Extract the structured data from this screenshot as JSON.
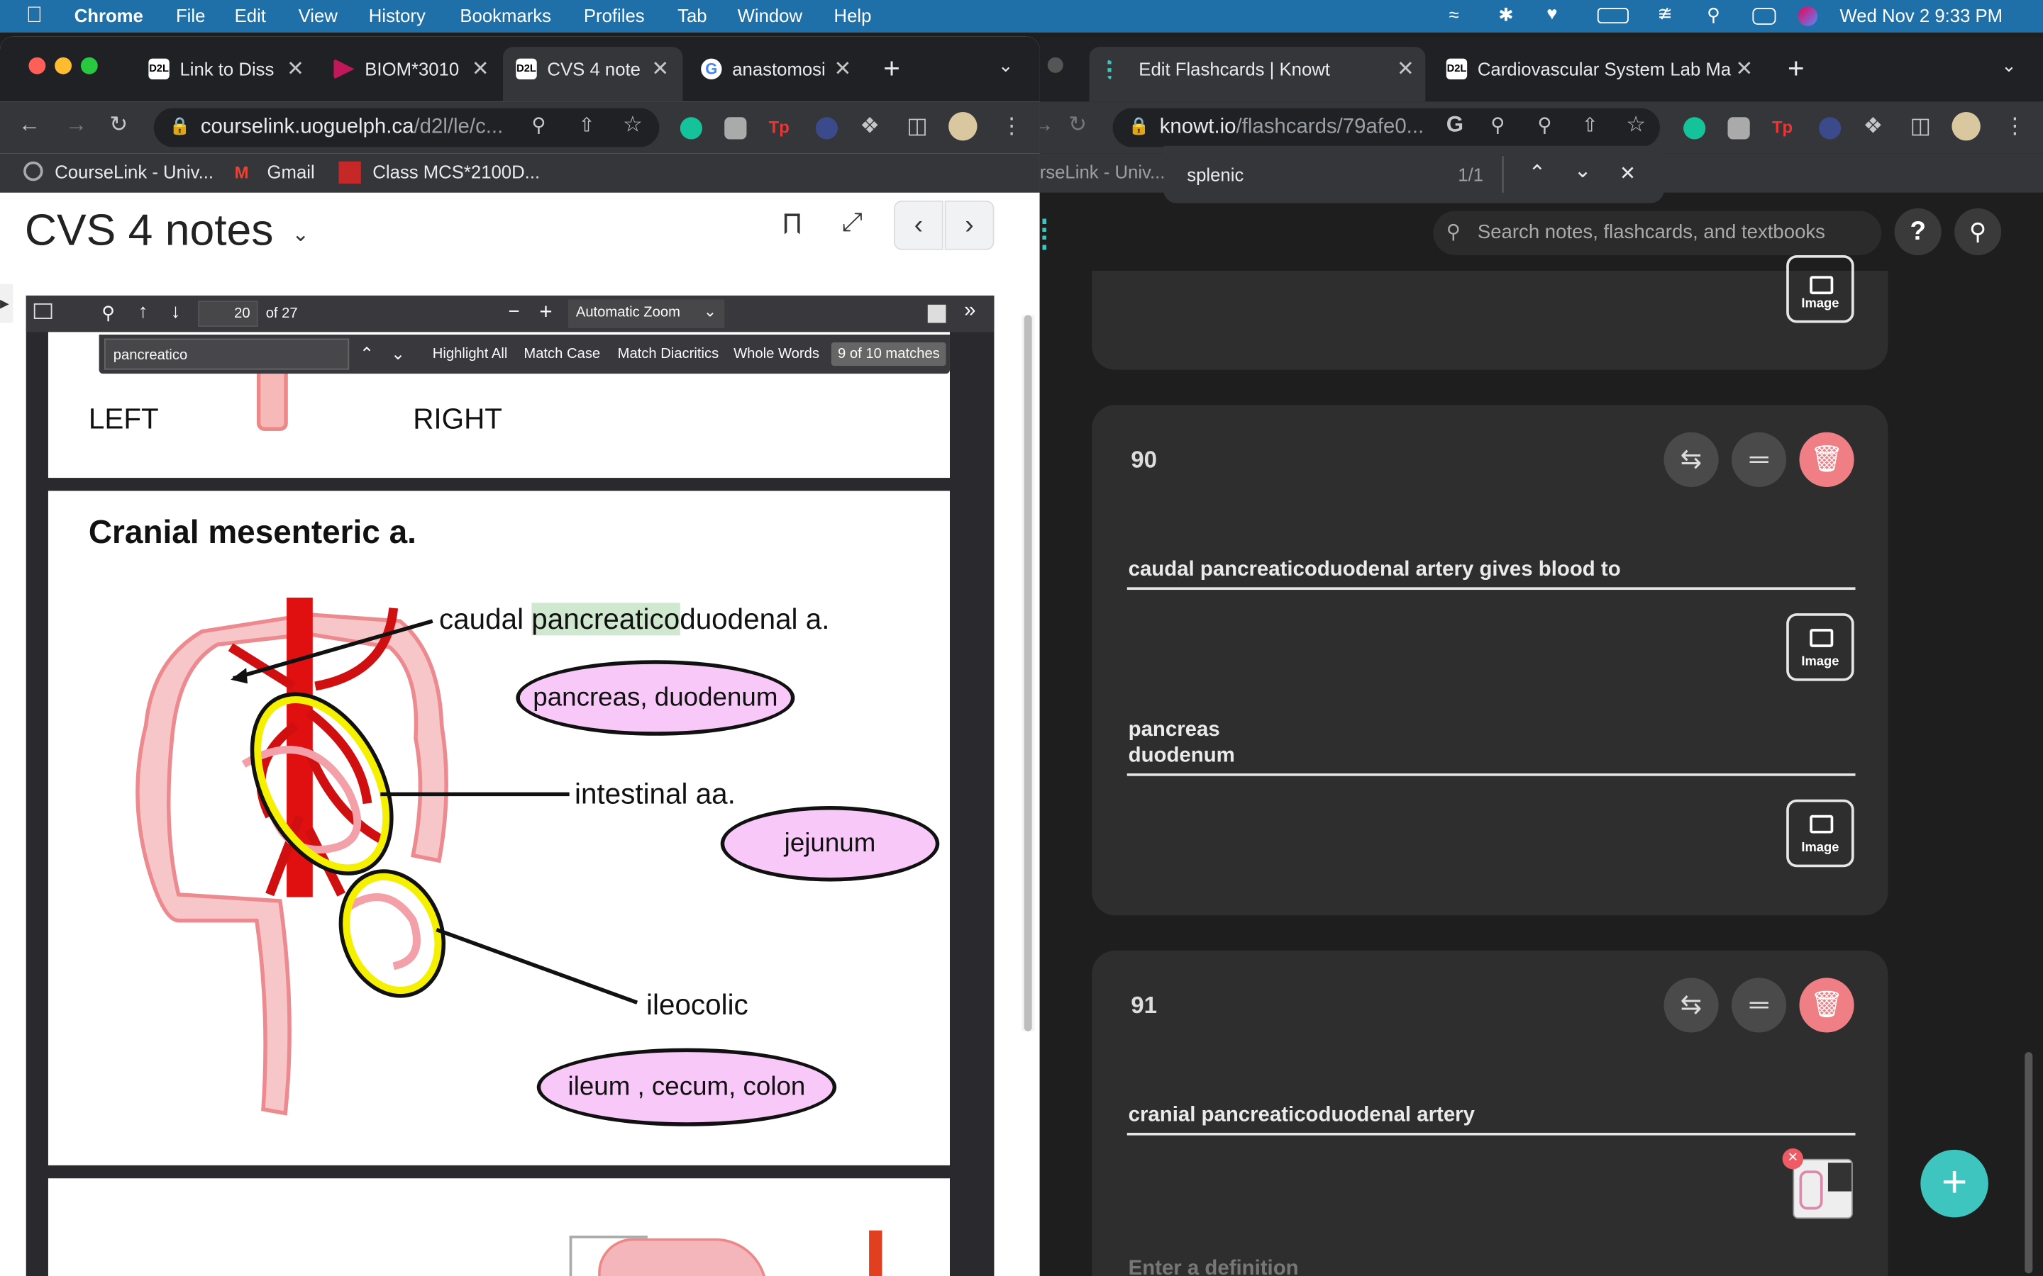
{
  "menubar": {
    "app": "Chrome",
    "items": [
      "File",
      "Edit",
      "View",
      "History",
      "Bookmarks",
      "Profiles",
      "Tab",
      "Window",
      "Help"
    ],
    "datetime": "Wed Nov 2  9:33 PM"
  },
  "left_window": {
    "tabs": [
      {
        "label": "Link to Diss",
        "fav": "D2L"
      },
      {
        "label": "BIOM*3010",
        "fav": "B"
      },
      {
        "label": "CVS 4 note",
        "fav": "D2L"
      },
      {
        "label": "anastomosi",
        "fav": "G"
      }
    ],
    "url_host": "courselink.uoguelph.ca",
    "url_path": "/d2l/le/c...",
    "bookmarks": [
      "CourseLink - Univ...",
      "Gmail",
      "Class MCS*2100D..."
    ],
    "doc_title": "CVS 4 notes",
    "pdf": {
      "page_number": "20",
      "page_of": "of 27",
      "zoom": "Automatic Zoom",
      "find_query": "pancreatico",
      "find_options": [
        "Highlight All",
        "Match Case",
        "Match Diacritics",
        "Whole Words"
      ],
      "find_result": "9 of 10 matches",
      "prev_page": {
        "left": "LEFT",
        "right": "RIGHT"
      },
      "page": {
        "heading": "Cranial mesenteric a.",
        "label_caudal_pre": "caudal ",
        "label_caudal_hl": "pancreatico",
        "label_caudal_post": "duodenal a.",
        "label_intestinal": "intestinal aa.",
        "label_ileocolic": "ileocolic",
        "pill_pancreas": "pancreas, duodenum",
        "pill_jejunum": "jejunum",
        "pill_ileum": "ileum , cecum, colon"
      }
    }
  },
  "right_window": {
    "tabs": [
      {
        "label": "Edit Flashcards | Knowt"
      },
      {
        "label": "Cardiovascular System Lab Ma",
        "fav": "D2L"
      }
    ],
    "url_host": "knowt.io",
    "url_path": "/flashcards/79afe0...",
    "bookmark_partial": "rseLink - Univ...",
    "find": {
      "query": "splenic",
      "count": "1/1"
    },
    "search_placeholder": "Search notes, flashcards, and textbooks",
    "image_btn": "Image",
    "cards": [
      {
        "number": "90",
        "term": "caudal pancreaticoduodenal artery gives blood to",
        "definition_line1": "pancreas",
        "definition_line2": "duodenum"
      },
      {
        "number": "91",
        "term": "cranial pancreaticoduodenal artery",
        "definition_placeholder": "Enter a definition"
      }
    ]
  },
  "colors": {
    "menubar": "#1f6fa9",
    "fab": "#3fc5bf",
    "delete": "#ef7f84",
    "highlight": "#cfe8cf"
  }
}
